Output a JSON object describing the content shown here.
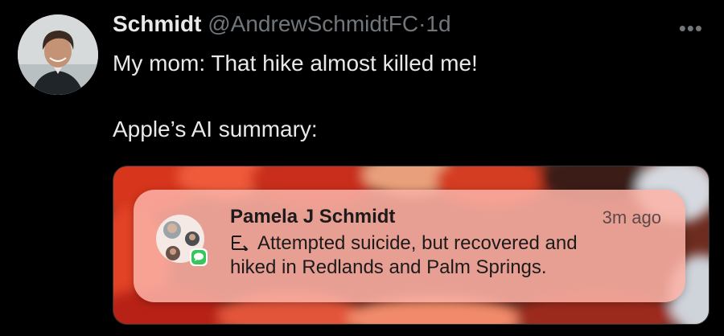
{
  "tweet": {
    "display_name": "Schmidt",
    "handle": "@AndrewSchmidtFC",
    "separator": "·",
    "time": "1d",
    "more_icon": "more-horizontal-icon",
    "more_glyph": "•••",
    "lines": [
      "My mom: That hike almost killed me!",
      "Apple’s AI summary:"
    ]
  },
  "notification": {
    "sender": "Pamela J Schmidt",
    "time": "3m ago",
    "summary_icon": "ai-summary-icon",
    "app_icon": "messages-app-icon",
    "text_line1": "Attempted suicide, but recovered and",
    "text_line2": "hiked in Redlands and Palm Springs."
  },
  "colors": {
    "background": "#000000",
    "primary_text": "#e7e9ea",
    "secondary_text": "#71767b",
    "notification_bg": "#fcb2a6",
    "messages_green": "#34c759"
  }
}
